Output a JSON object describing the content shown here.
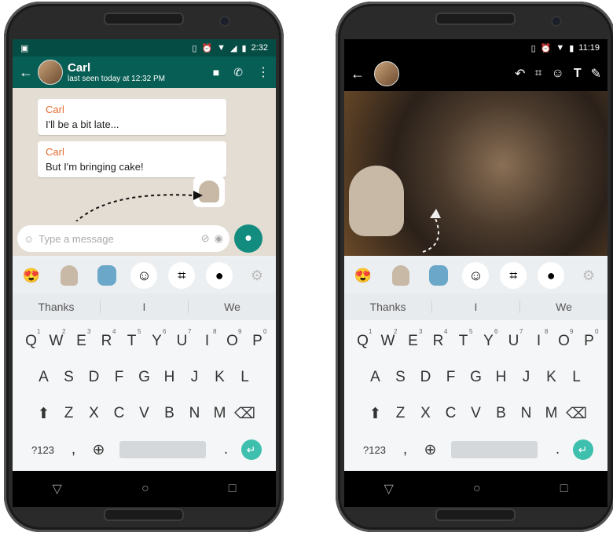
{
  "left_phone": {
    "status_time": "2:32",
    "contact_name": "Carl",
    "contact_status": "last seen today at 12:32 PM",
    "messages": [
      {
        "sender": "Carl",
        "text": "I'll be a bit late..."
      },
      {
        "sender": "Carl",
        "text": "But I'm bringing cake!"
      }
    ],
    "input_placeholder": "Type a message"
  },
  "right_phone": {
    "status_time": "11:19"
  },
  "keyboard": {
    "suggestions": [
      "Thanks",
      "I",
      "We"
    ],
    "row1": [
      {
        "key": "Q",
        "num": "1"
      },
      {
        "key": "W",
        "num": "2"
      },
      {
        "key": "E",
        "num": "3"
      },
      {
        "key": "R",
        "num": "4"
      },
      {
        "key": "T",
        "num": "5"
      },
      {
        "key": "Y",
        "num": "6"
      },
      {
        "key": "U",
        "num": "7"
      },
      {
        "key": "I",
        "num": "8"
      },
      {
        "key": "O",
        "num": "9"
      },
      {
        "key": "P",
        "num": "0"
      }
    ],
    "row2": [
      "A",
      "S",
      "D",
      "F",
      "G",
      "H",
      "J",
      "K",
      "L"
    ],
    "row3": [
      "Z",
      "X",
      "C",
      "V",
      "B",
      "N",
      "M"
    ],
    "symbols_label": "?123",
    "period_label": "."
  },
  "colors": {
    "whatsapp_green": "#075e54",
    "send_button": "#128c7e",
    "sender_name": "#e66a2c",
    "enter_key": "#3fbfad"
  }
}
